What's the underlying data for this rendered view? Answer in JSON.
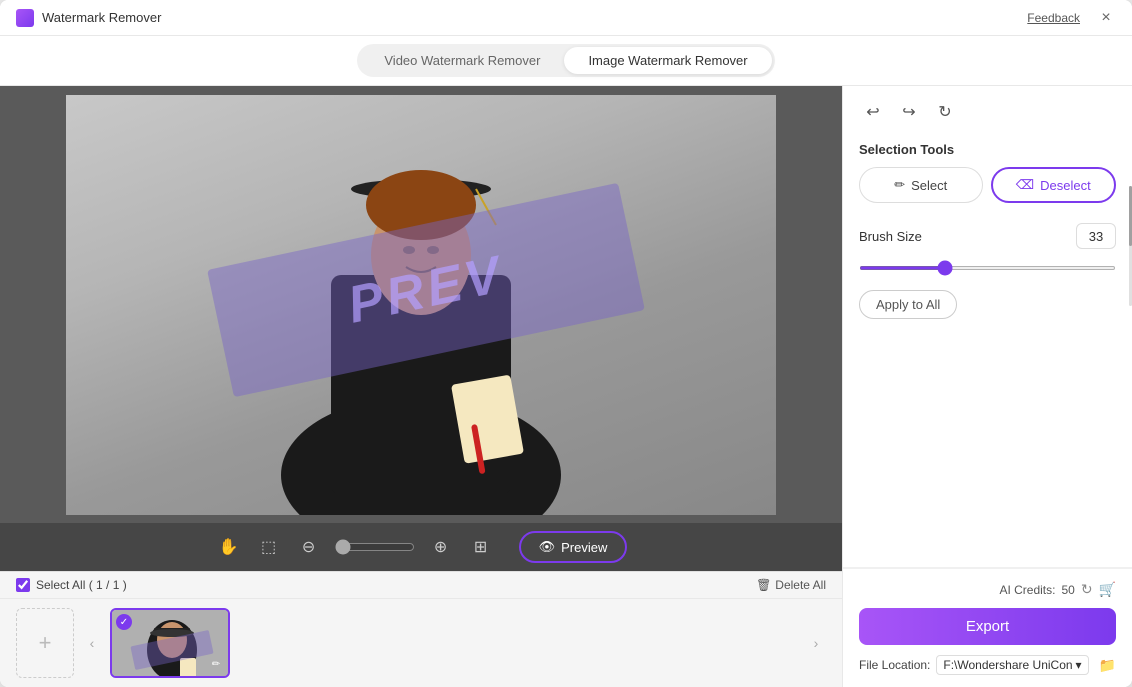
{
  "titleBar": {
    "title": "Watermark Remover",
    "feedback": "Feedback",
    "close": "×"
  },
  "tabs": {
    "video": "Video Watermark Remover",
    "image": "Image Watermark Remover",
    "activeTab": "image"
  },
  "toolbar": {
    "preview": "Preview",
    "zoomMin": "0",
    "zoomDefault": "0"
  },
  "filmstrip": {
    "selectAllLabel": "Select All ( 1 / 1 )",
    "deleteAll": "Delete All",
    "addBtn": "+",
    "prevArrow": "<",
    "nextArrow": ">"
  },
  "rightPanel": {
    "selectionTools": {
      "label": "Selection Tools",
      "selectBtn": "Select",
      "deselectBtn": "Deselect"
    },
    "brushSize": {
      "label": "Brush Size",
      "value": "33"
    },
    "applyToAll": "Apply to All",
    "aiCredits": {
      "label": "AI Credits:",
      "value": "50"
    },
    "exportBtn": "Export",
    "fileLocation": {
      "label": "File Location:",
      "path": "F:\\Wondershare UniCon"
    }
  },
  "watermark": {
    "text": "PREV"
  },
  "colors": {
    "accent": "#7c3aed",
    "accentLight": "#a855f7"
  }
}
